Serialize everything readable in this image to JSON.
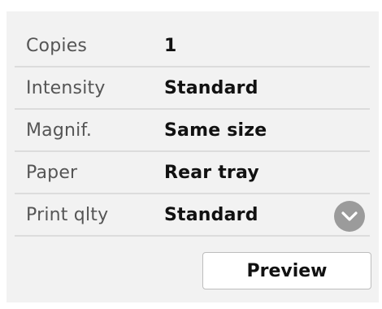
{
  "settings": {
    "rows": [
      {
        "label": "Copies",
        "value": "1"
      },
      {
        "label": "Intensity",
        "value": "Standard"
      },
      {
        "label": "Magnif.",
        "value": "Same size"
      },
      {
        "label": "Paper",
        "value": "Rear tray"
      },
      {
        "label": "Print qlty",
        "value": "Standard"
      }
    ]
  },
  "actions": {
    "preview_label": "Preview",
    "scroll_icon": "chevron-down-icon"
  },
  "colors": {
    "panel_background": "#f2f2f2",
    "divider": "#dcdcdc",
    "scroll_button": "#9b9b9b"
  }
}
